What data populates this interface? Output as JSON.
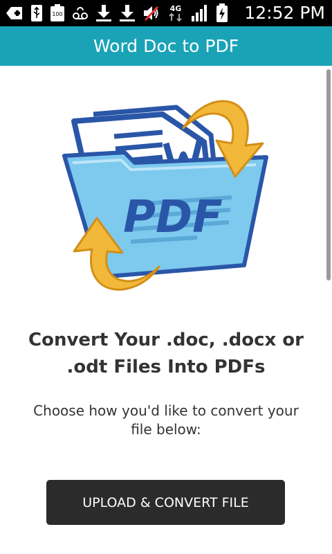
{
  "status_bar": {
    "time": "12:52 PM",
    "network_label": "4G",
    "battery_saver_label": "100",
    "icons": [
      "add-icon",
      "usb-icon",
      "battery-saver-icon",
      "voicemail-icon",
      "download-icon",
      "download-icon",
      "mute-icon",
      "network-4g-icon",
      "signal-icon",
      "battery-charging-icon"
    ]
  },
  "app_bar": {
    "title": "Word Doc to PDF",
    "color": "#1aa3b7"
  },
  "logo": {
    "icon": "word-to-pdf-logo-icon",
    "text": "PDF"
  },
  "main": {
    "headline_line1": "Convert Your .doc, .docx or",
    "headline_line2": ".odt Files Into PDFs",
    "instruction_line1": "Choose how you'd like to convert your",
    "instruction_line2": "file below:",
    "upload_button_label": "UPLOAD & CONVERT FILE"
  },
  "colors": {
    "button_bg": "#2b2b2b",
    "text": "#333333",
    "logo_blue": "#2a56a8",
    "logo_arrow": "#f2b83a"
  }
}
